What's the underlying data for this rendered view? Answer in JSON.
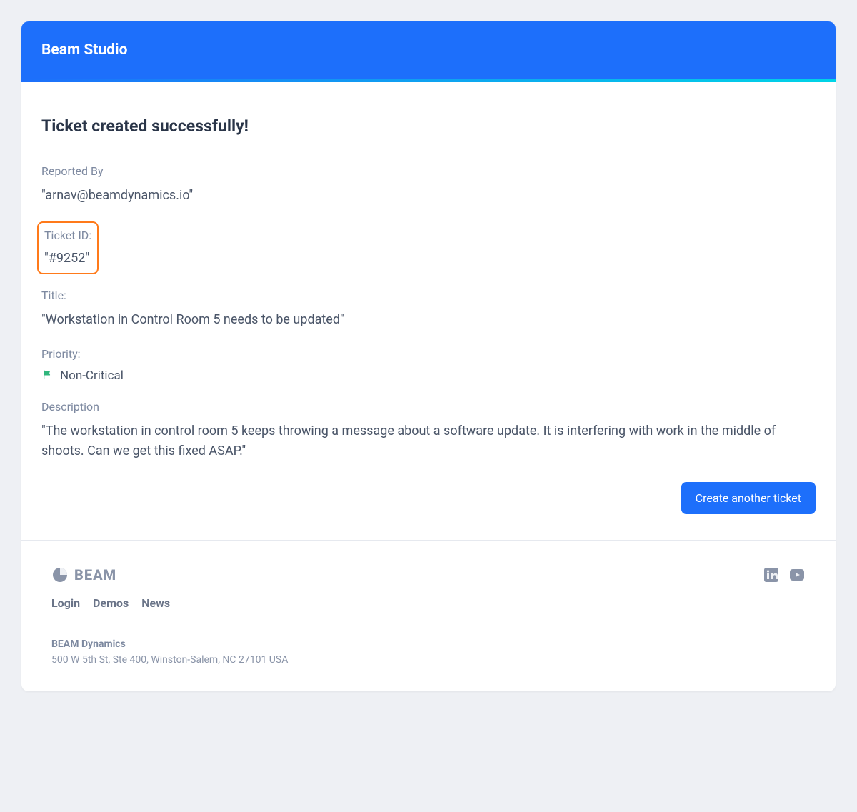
{
  "header": {
    "title": "Beam Studio"
  },
  "page": {
    "heading": "Ticket created successfully!",
    "reported_by_label": "Reported By",
    "reported_by_value": "\"arnav@beamdynamics.io\"",
    "ticket_id_label": "Ticket ID:",
    "ticket_id_value": "\"#9252\"",
    "title_label": "Title:",
    "title_value": "\"Workstation in Control Room 5 needs to be updated\"",
    "priority_label": "Priority:",
    "priority_value": "Non-Critical",
    "description_label": "Description",
    "description_value": "\"The workstation in control room 5 keeps throwing a message about a software update. It is interfering with work in the middle of shoots. Can we get this fixed ASAP.\"",
    "create_button_label": "Create another ticket"
  },
  "footer": {
    "logo_text": "BEAM",
    "links": {
      "login": "Login",
      "demos": "Demos",
      "news": "News"
    },
    "company_name": "BEAM Dynamics",
    "address": "500 W 5th St, Ste 400, Winston-Salem, NC 27101 USA"
  }
}
